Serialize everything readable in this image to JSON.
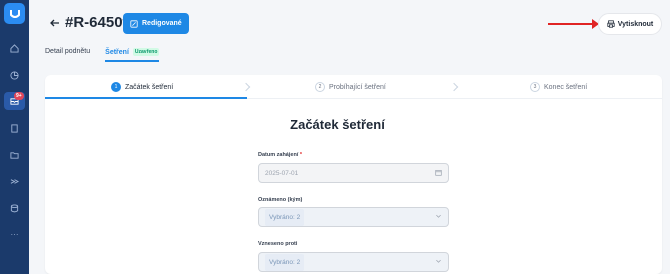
{
  "header": {
    "back_icon": "arrow-left-icon",
    "title": "#R-6450f",
    "status_label": "Redigované",
    "print_label": "Vytisknout"
  },
  "sidebar": {
    "notification_badge": "9+"
  },
  "tabs": [
    {
      "label": "Detail podnětu"
    },
    {
      "label": "Šetření",
      "badge": "Uzavřeno"
    }
  ],
  "steps": [
    {
      "num": "1",
      "label": "Začátek šetření"
    },
    {
      "num": "2",
      "label": "Probíhající šetření"
    },
    {
      "num": "3",
      "label": "Konec šetření"
    }
  ],
  "form": {
    "title": "Začátek šetření",
    "date_label": "Datum zahájení",
    "date_required": "*",
    "date_value": "2025-07-01",
    "notified_label": "Oznámeno (kým)",
    "notified_value": "Vybráno: 2",
    "raised_label": "Vzneseno proti",
    "raised_value": "Vybráno: 2"
  },
  "colors": {
    "primary": "#1e88e5",
    "sidebar": "#1b3a6b",
    "danger": "#e02424"
  }
}
